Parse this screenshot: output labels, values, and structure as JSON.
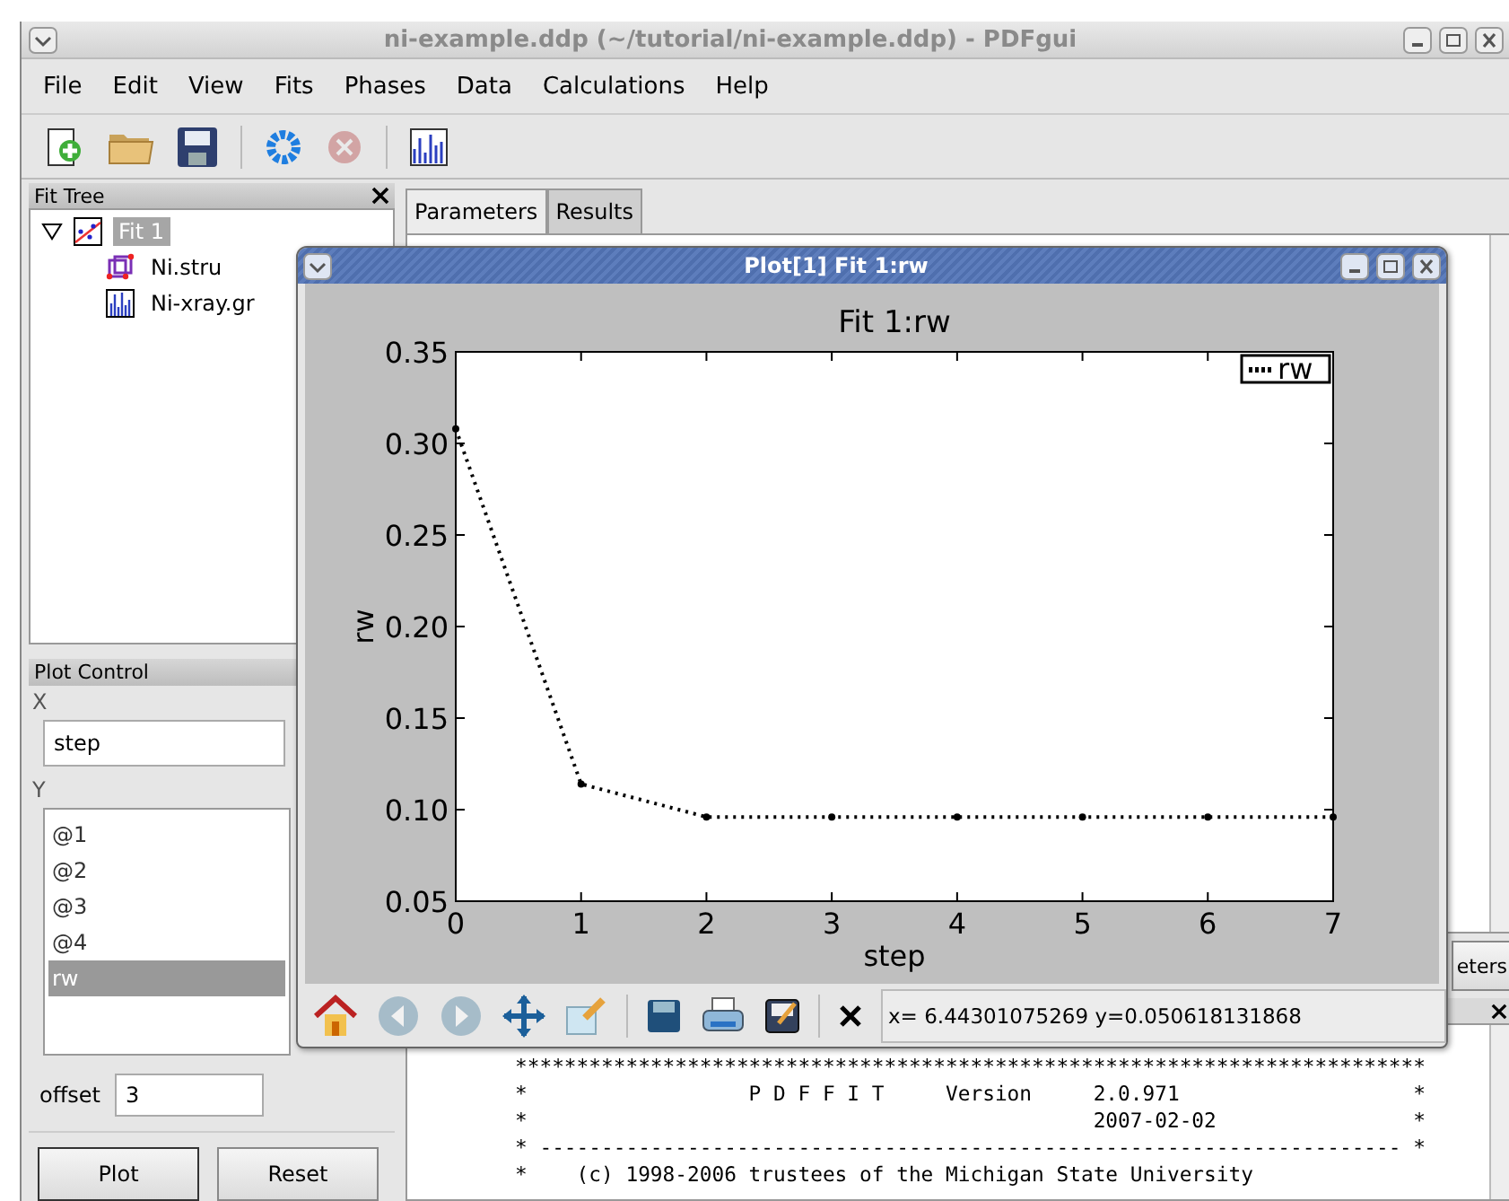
{
  "window": {
    "title": "ni-example.ddp (~/tutorial/ni-example.ddp) - PDFgui"
  },
  "menu": [
    {
      "label": "File"
    },
    {
      "label": "Edit"
    },
    {
      "label": "View"
    },
    {
      "label": "Fits"
    },
    {
      "label": "Phases"
    },
    {
      "label": "Data"
    },
    {
      "label": "Calculations"
    },
    {
      "label": "Help"
    }
  ],
  "toolbar": [
    {
      "kind": "new",
      "disabled": false
    },
    {
      "kind": "open",
      "disabled": false
    },
    {
      "kind": "save",
      "disabled": false
    },
    {
      "kind": "separator",
      "disabled": false
    },
    {
      "kind": "run",
      "disabled": false
    },
    {
      "kind": "stop",
      "disabled": true
    },
    {
      "kind": "separator",
      "disabled": false
    },
    {
      "kind": "datagraph",
      "disabled": false
    }
  ],
  "fit_tree": {
    "title": "Fit Tree",
    "items": [
      {
        "label": "Fit 1",
        "kind": "fit",
        "selected": true,
        "expanded": true,
        "children": [
          {
            "label": "Ni.stru",
            "kind": "phase",
            "selected": false
          },
          {
            "label": "Ni-xray.gr",
            "kind": "dataset",
            "selected": false
          }
        ]
      }
    ]
  },
  "plot_control": {
    "title": "Plot Control",
    "x_label": "X",
    "x_value": "step",
    "y_label": "Y",
    "y_items": [
      {
        "label": "@1",
        "selected": false
      },
      {
        "label": "@2",
        "selected": false
      },
      {
        "label": "@3",
        "selected": false
      },
      {
        "label": "@4",
        "selected": false
      },
      {
        "label": "rw",
        "selected": true
      }
    ],
    "offset_label": "offset",
    "offset_value": "3",
    "buttons": [
      "Plot",
      "Reset"
    ]
  },
  "tabs": [
    {
      "label": "Parameters",
      "selected": true
    },
    {
      "label": "Results",
      "selected": false
    }
  ],
  "side_button": "eters",
  "output": {
    "lines": [
      "**************************************************************************",
      "*                  P D F F I T     Version     2.0.971                   *",
      "*                                              2007-02-02                *",
      "* ---------------------------------------------------------------------- *",
      "*    (c) 1998-2006 trustees of the Michigan State University"
    ]
  },
  "plot_window": {
    "title": "Plot[1]  Fit 1:rw",
    "chart_data": {
      "type": "line",
      "title": "Fit 1:rw",
      "xlabel": "step",
      "ylabel": "rw",
      "x": [
        0,
        1,
        2,
        3,
        4,
        5,
        6,
        7
      ],
      "series": [
        {
          "name": "rw",
          "color": "#000000",
          "line_style": "dotted",
          "marker": "o",
          "values": [
            0.308,
            0.114,
            0.096,
            0.096,
            0.096,
            0.096,
            0.096,
            0.096
          ]
        }
      ],
      "xlim": [
        0,
        7
      ],
      "ylim": [
        0.05,
        0.35
      ],
      "xticks": [
        0,
        1,
        2,
        3,
        4,
        5,
        6,
        7
      ],
      "yticks": [
        {
          "value": 0.05,
          "label": "0.05"
        },
        {
          "value": 0.1,
          "label": "0.10"
        },
        {
          "value": 0.15,
          "label": "0.15"
        },
        {
          "value": 0.2,
          "label": "0.20"
        },
        {
          "value": 0.25,
          "label": "0.25"
        },
        {
          "value": 0.3,
          "label": "0.30"
        },
        {
          "value": 0.35,
          "label": "0.35"
        }
      ]
    },
    "toolbar": [
      {
        "kind": "home",
        "disabled": false
      },
      {
        "kind": "back",
        "disabled": true
      },
      {
        "kind": "forward",
        "disabled": true
      },
      {
        "kind": "pan",
        "disabled": false
      },
      {
        "kind": "edit",
        "disabled": false
      },
      {
        "kind": "separator",
        "disabled": false
      },
      {
        "kind": "save",
        "disabled": false
      },
      {
        "kind": "print",
        "disabled": false
      },
      {
        "kind": "export",
        "disabled": false
      },
      {
        "kind": "separator",
        "disabled": false
      },
      {
        "kind": "close",
        "disabled": false
      }
    ],
    "status": "x= 6.44301075269  y=0.050618131868"
  }
}
